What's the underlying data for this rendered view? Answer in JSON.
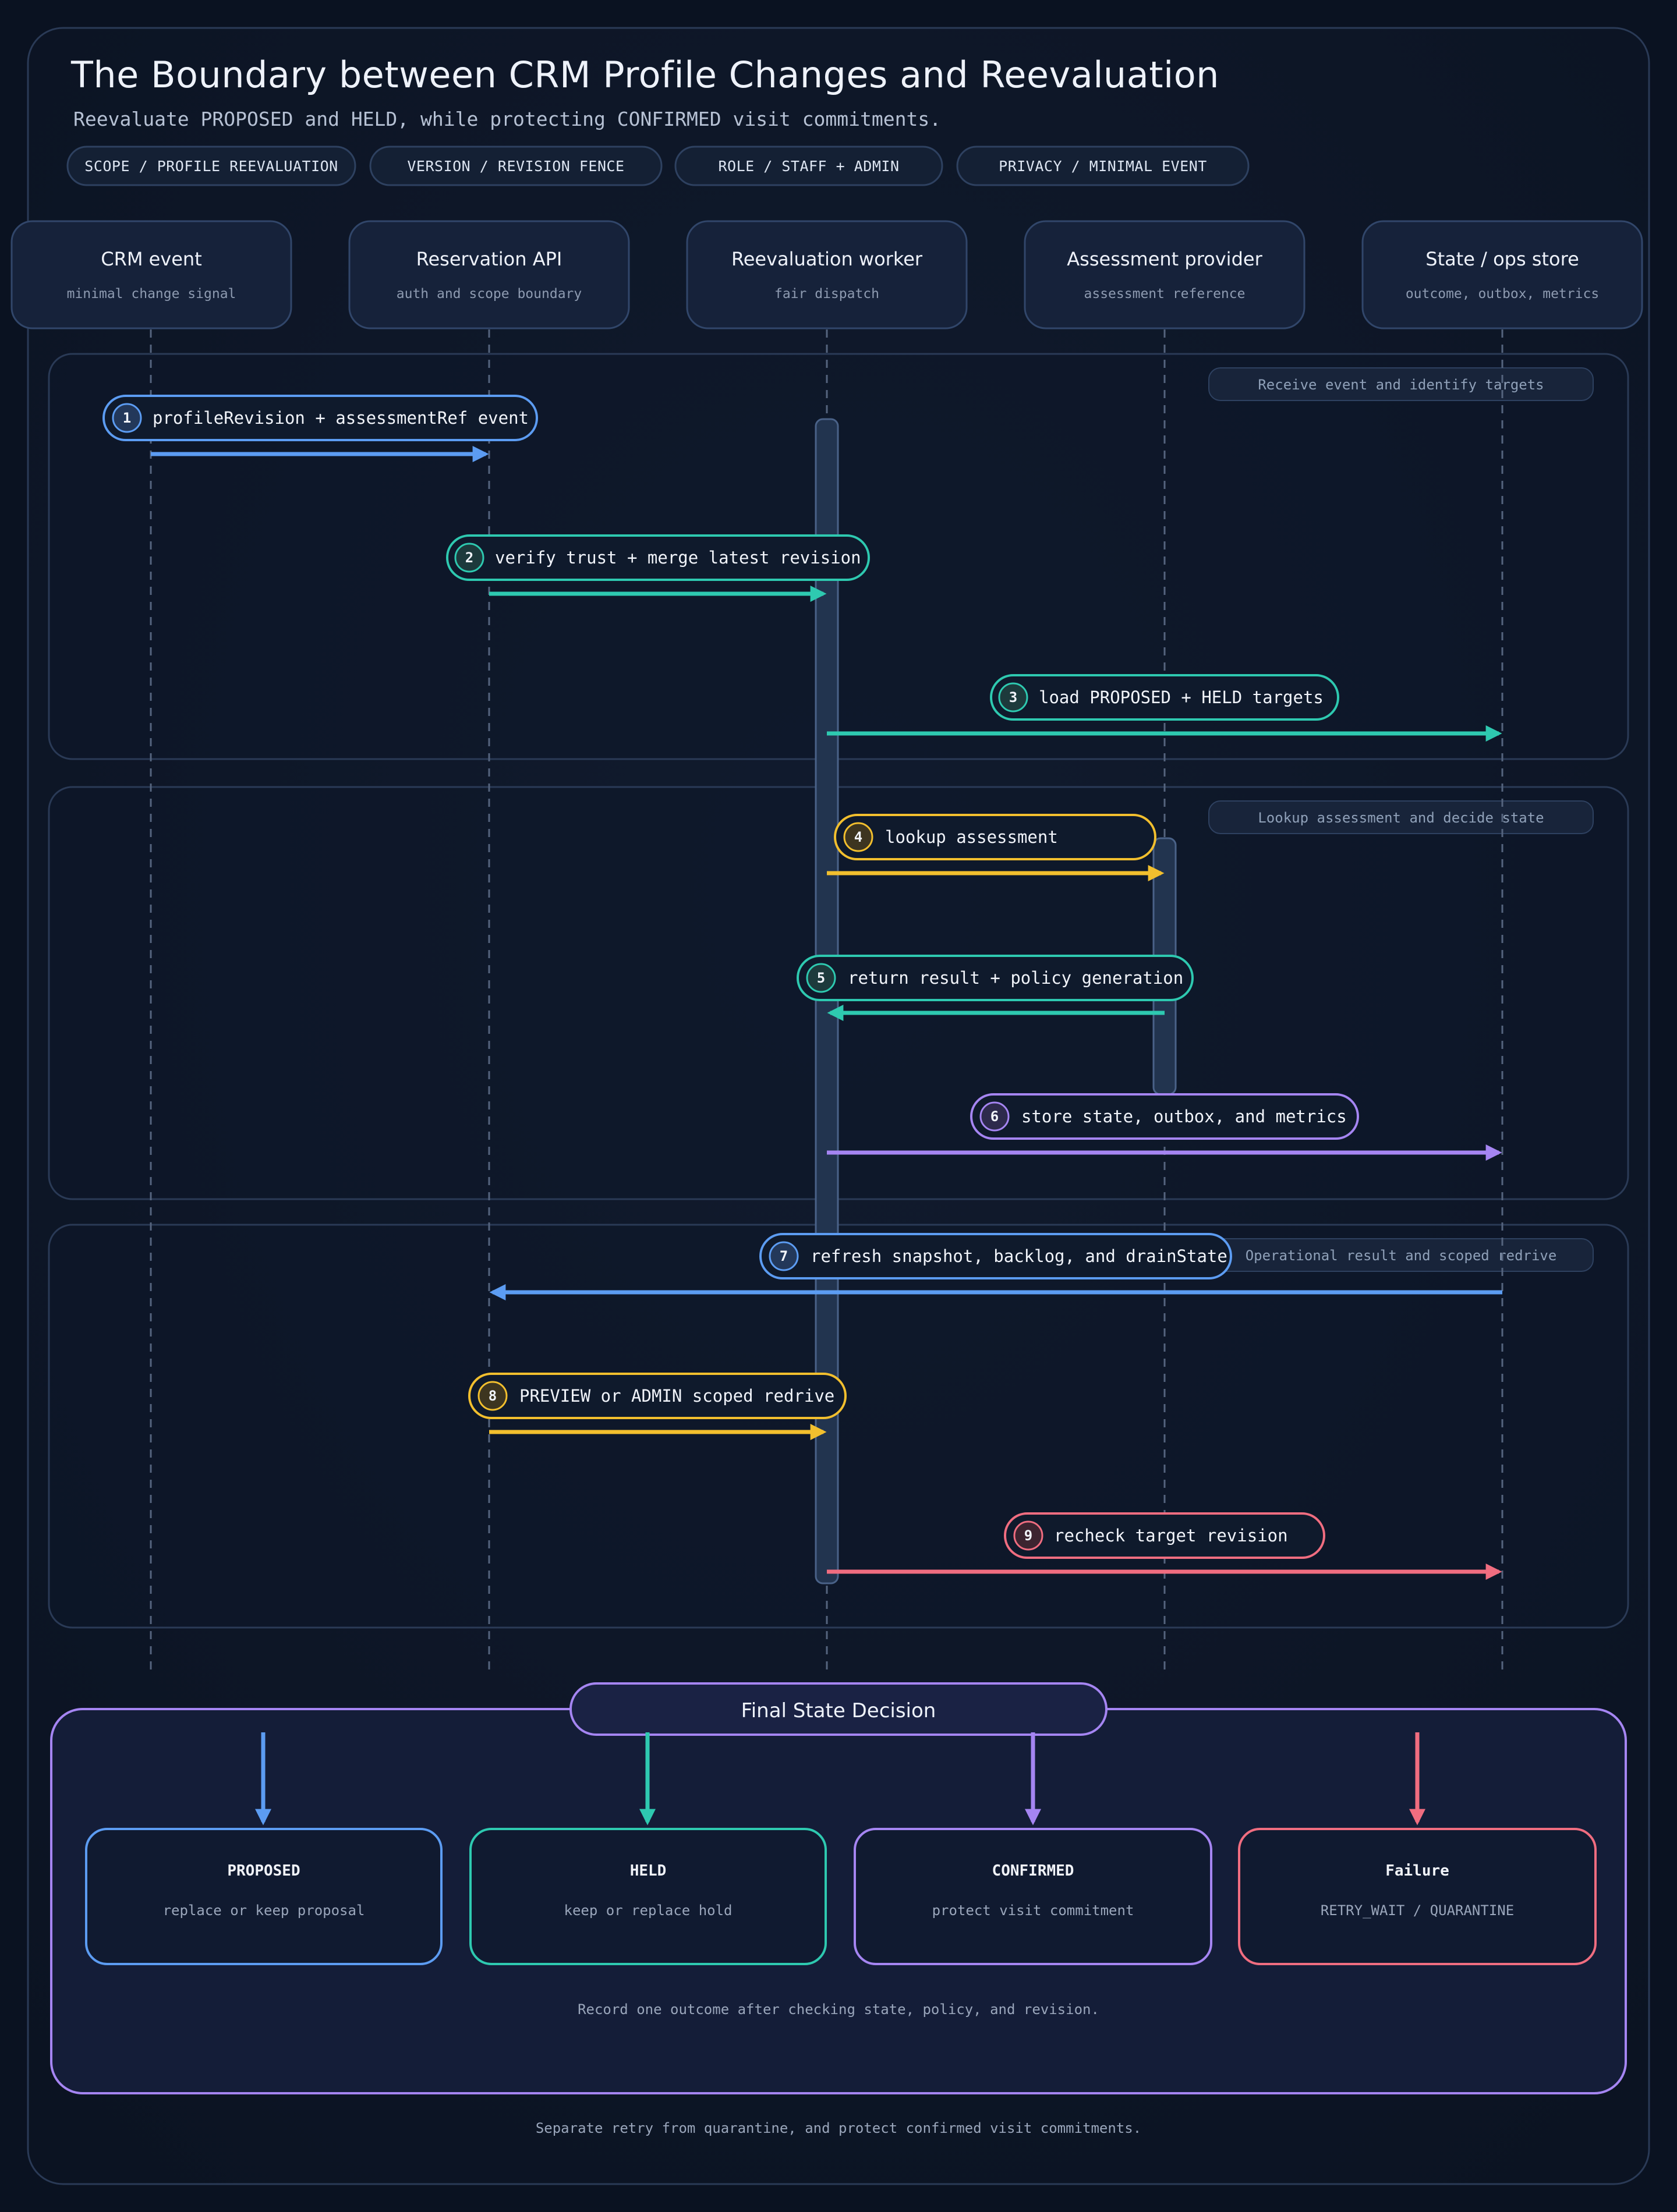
{
  "title": "The Boundary between CRM Profile Changes and Reevaluation",
  "subtitle": "Reevaluate PROPOSED and HELD, while protecting CONFIRMED visit commitments.",
  "chips": [
    "SCOPE / PROFILE REEVALUATION",
    "VERSION / REVISION FENCE",
    "ROLE / STAFF + ADMIN",
    "PRIVACY / MINIMAL EVENT"
  ],
  "participants": [
    {
      "title": "CRM event",
      "subtitle": "minimal change signal"
    },
    {
      "title": "Reservation API",
      "subtitle": "auth and scope boundary"
    },
    {
      "title": "Reevaluation worker",
      "subtitle": "fair dispatch"
    },
    {
      "title": "Assessment provider",
      "subtitle": "assessment reference"
    },
    {
      "title": "State / ops store",
      "subtitle": "outcome, outbox, metrics"
    }
  ],
  "phases": [
    "Receive event and identify targets",
    "Lookup assessment and decide state",
    "Operational result and scoped redrive"
  ],
  "messages": [
    {
      "num": "1",
      "label": "profileRevision + assessmentRef event",
      "from": 0,
      "to": 1,
      "color": "#5c9cf2"
    },
    {
      "num": "2",
      "label": "verify trust + merge latest revision",
      "from": 1,
      "to": 2,
      "color": "#2ec9b0"
    },
    {
      "num": "3",
      "label": "load PROPOSED + HELD targets",
      "from": 2,
      "to": 4,
      "color": "#2ec9b0"
    },
    {
      "num": "4",
      "label": "lookup assessment",
      "from": 2,
      "to": 3,
      "color": "#f2bf2e"
    },
    {
      "num": "5",
      "label": "return result + policy generation",
      "from": 3,
      "to": 2,
      "color": "#2ec9b0"
    },
    {
      "num": "6",
      "label": "store state, outbox, and metrics",
      "from": 2,
      "to": 4,
      "color": "#a585f2"
    },
    {
      "num": "7",
      "label": "refresh snapshot, backlog, and drainState",
      "from": 4,
      "to": 1,
      "color": "#5c9cf2"
    },
    {
      "num": "8",
      "label": "PREVIEW or ADMIN scoped redrive",
      "from": 1,
      "to": 2,
      "color": "#f2bf2e"
    },
    {
      "num": "9",
      "label": "recheck target revision",
      "from": 2,
      "to": 4,
      "color": "#f06d80"
    }
  ],
  "decision": {
    "title": "Final State Decision",
    "outcomes": [
      {
        "title": "PROPOSED",
        "subtitle": "replace or keep proposal",
        "color": "#5c9cf2"
      },
      {
        "title": "HELD",
        "subtitle": "keep or replace hold",
        "color": "#2ec9b0"
      },
      {
        "title": "CONFIRMED",
        "subtitle": "protect visit commitment",
        "color": "#a585f2"
      },
      {
        "title": "Failure",
        "subtitle": "RETRY_WAIT / QUARANTINE",
        "color": "#f06d80"
      }
    ],
    "note": "Record one outcome after checking state, policy, and revision."
  },
  "footer": "Separate retry from quarantine, and protect confirmed visit commitments."
}
